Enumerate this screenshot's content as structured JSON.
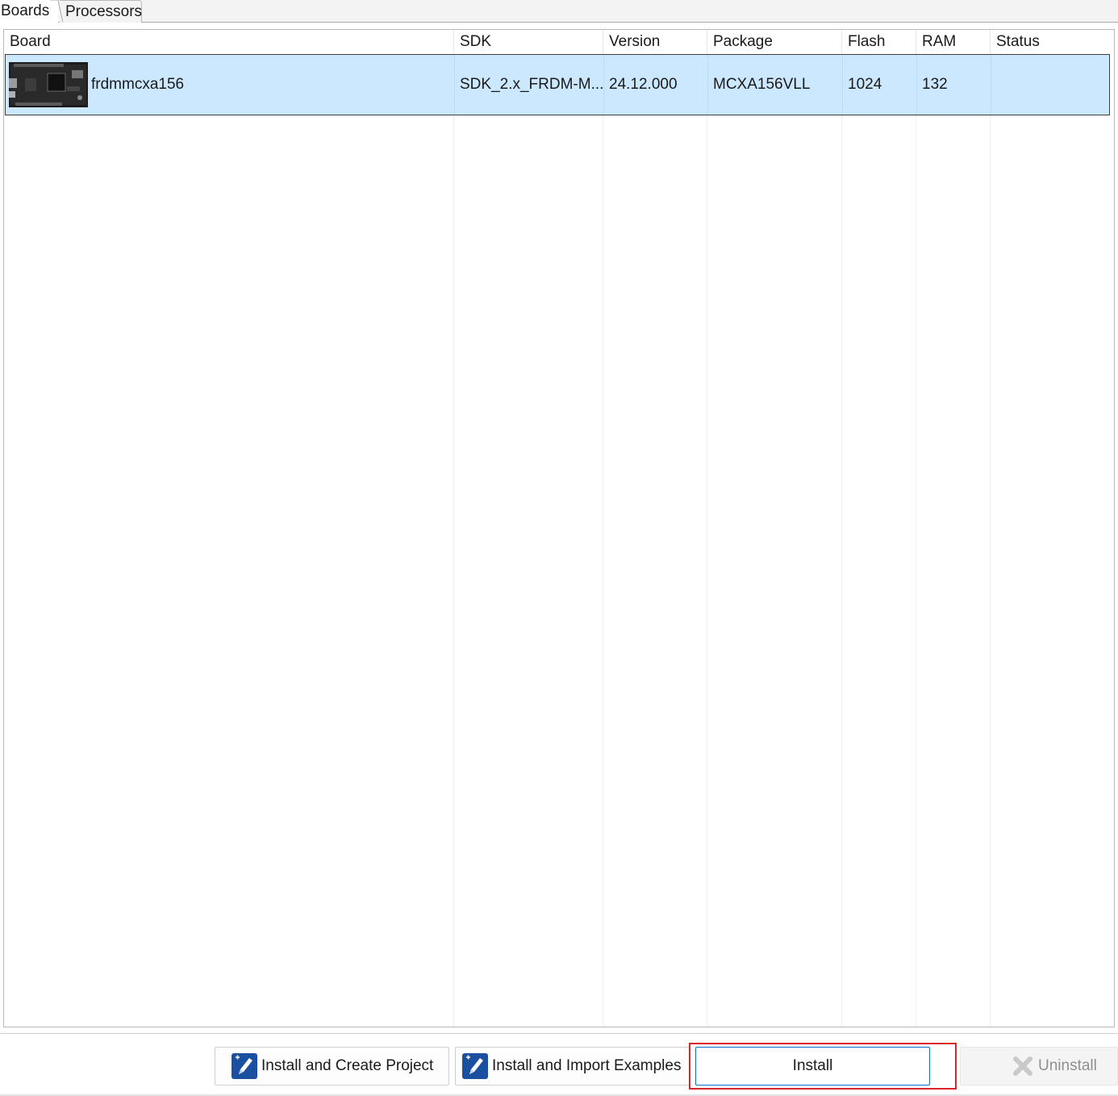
{
  "tabs": [
    {
      "label": "Boards",
      "active": true
    },
    {
      "label": "Processors",
      "active": false
    }
  ],
  "table": {
    "columns": [
      "Board",
      "SDK",
      "Version",
      "Package",
      "Flash",
      "RAM",
      "Status"
    ],
    "rows": [
      {
        "board": "frdmmcxa156",
        "sdk": "SDK_2.x_FRDM-M...",
        "version": "24.12.000",
        "package": "MCXA156VLL",
        "flash": "1024",
        "ram": "132",
        "status": "",
        "selected": true,
        "icon": "board-photo"
      }
    ]
  },
  "buttons": {
    "install_create": "Install and Create Project",
    "install_import": "Install and Import Examples",
    "install": "Install",
    "uninstall": "Uninstall"
  },
  "colors": {
    "selection": "#cce8ff",
    "highlight_border": "#d9242a",
    "focus_border": "#0a6fc8",
    "icon_blue": "#1b4fa0"
  }
}
